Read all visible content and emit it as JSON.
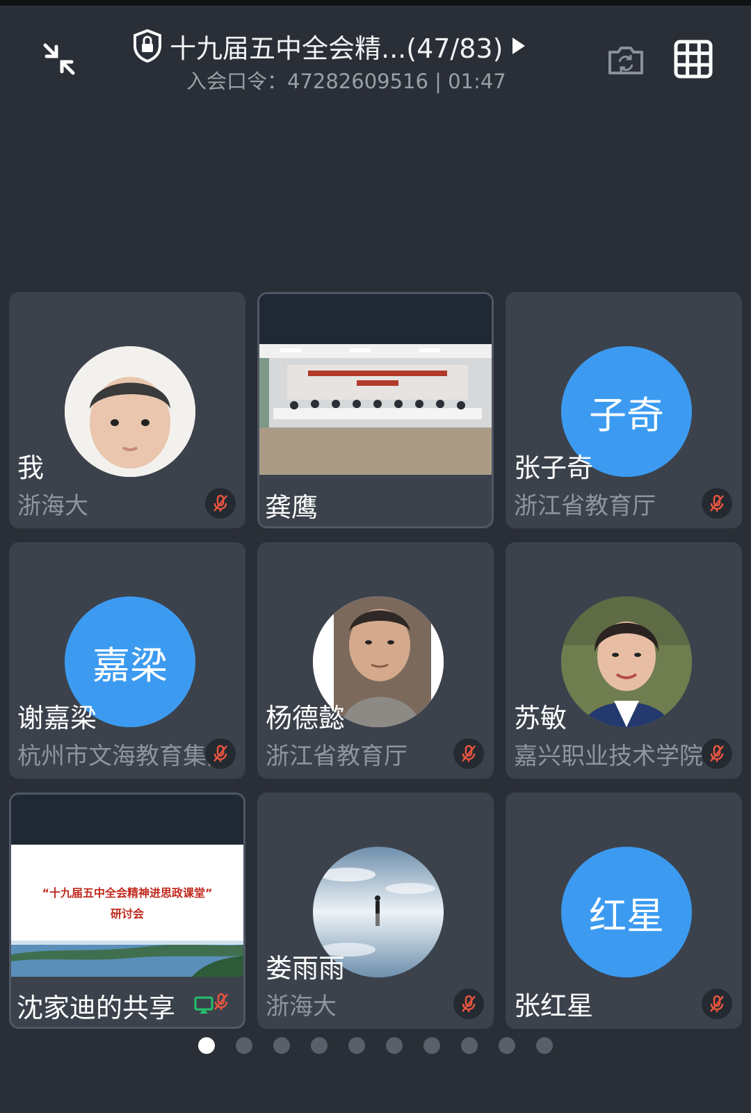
{
  "header": {
    "title": "十九届五中全会精...(47/83)",
    "subtitle": "入会口令：47282609516 | 01:47",
    "icons": {
      "minimize": "minimize-arrows-icon",
      "lock": "shield-lock-icon",
      "flip_camera": "camera-switch-icon",
      "grid": "grid-view-icon",
      "play": "play-triangle-icon"
    }
  },
  "participants": [
    {
      "name": "我",
      "org": "浙海大",
      "type": "photo",
      "muted": true
    },
    {
      "name": "龚鹰",
      "org": "",
      "type": "video",
      "muted": false
    },
    {
      "name": "张子奇",
      "org": "浙江省教育厅",
      "type": "initials",
      "initials": "子奇",
      "muted": true
    },
    {
      "name": "谢嘉梁",
      "org": "杭州市文海教育集团",
      "type": "initials",
      "initials": "嘉梁",
      "muted": true
    },
    {
      "name": "杨德懿",
      "org": "浙江省教育厅",
      "type": "photo",
      "muted": true
    },
    {
      "name": "苏敏",
      "org": "嘉兴职业技术学院",
      "type": "photo",
      "muted": true
    },
    {
      "name": "沈家迪的共享",
      "org": "",
      "type": "screen-share",
      "share_line1": "“十九届五中全会精神进思政课堂”",
      "share_line2": "研讨会",
      "muted": true
    },
    {
      "name": "娄雨雨",
      "org": "浙海大",
      "type": "photo",
      "muted": true
    },
    {
      "name": "张红星",
      "org": "",
      "type": "initials",
      "initials": "红星",
      "muted": true
    }
  ],
  "pagination": {
    "total": 10,
    "active_index": 0
  },
  "colors": {
    "background": "#2a2e36",
    "tile": "#3c424c",
    "initials_avatar": "#3c9bf1",
    "mute_icon": "#e8553f",
    "share_icon": "#23c16b"
  }
}
